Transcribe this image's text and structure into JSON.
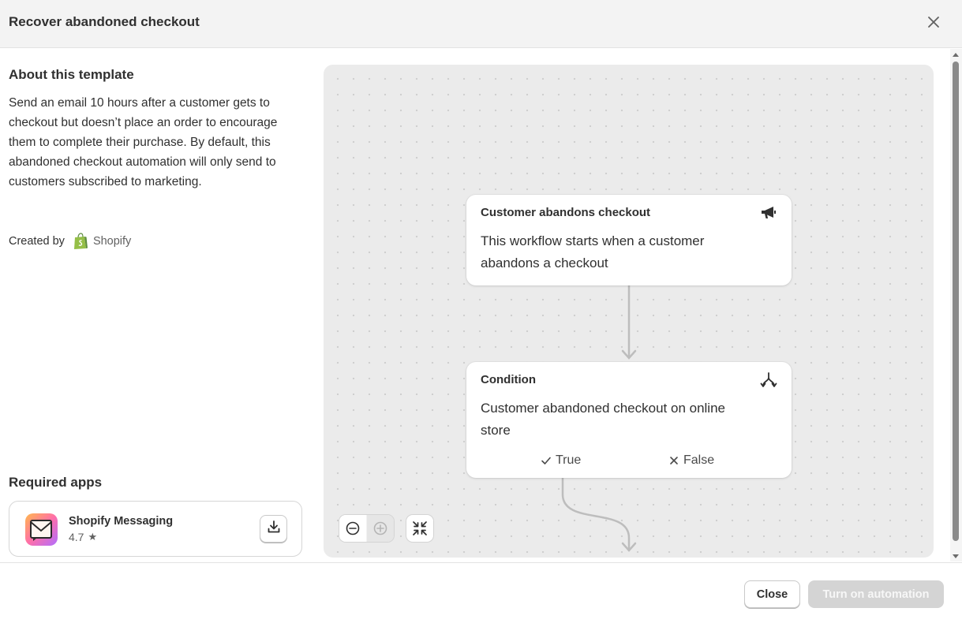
{
  "modal": {
    "title": "Recover abandoned checkout",
    "close_icon": "close-icon"
  },
  "about": {
    "heading": "About this template",
    "description": "Send an email 10 hours after a customer gets to checkout but doesn’t place an order to encourage them to complete their purchase. By default, this abandoned checkout automation will only send to customers subscribed to marketing.",
    "created_by_label": "Created by",
    "creator": "Shopify",
    "creator_icon": "shopify-bag-icon"
  },
  "required_apps": {
    "heading": "Required apps",
    "apps": [
      {
        "name": "Shopify Messaging",
        "rating": "4.7",
        "icon": "shopify-messaging-icon",
        "action_icon": "download-icon"
      }
    ]
  },
  "workflow": {
    "nodes": [
      {
        "title": "Customer abandons checkout",
        "body": "This workflow starts when a customer abandons a checkout",
        "icon": "megaphone-icon"
      },
      {
        "title": "Condition",
        "body": "Customer abandoned checkout on online store",
        "icon": "branch-icon",
        "branches": [
          {
            "label": "True",
            "icon": "check-icon"
          },
          {
            "label": "False",
            "icon": "x-icon"
          }
        ]
      }
    ],
    "controls": {
      "zoom_out_icon": "zoom-out-icon",
      "zoom_in_icon": "zoom-in-icon",
      "fit_icon": "collapse-icon"
    }
  },
  "footer": {
    "close_label": "Close",
    "turn_on_label": "Turn on automation"
  },
  "colors": {
    "canvas_bg": "#ebebeb",
    "disabled_button_bg": "#d4d4d4",
    "header_bg": "#f3f3f3"
  }
}
